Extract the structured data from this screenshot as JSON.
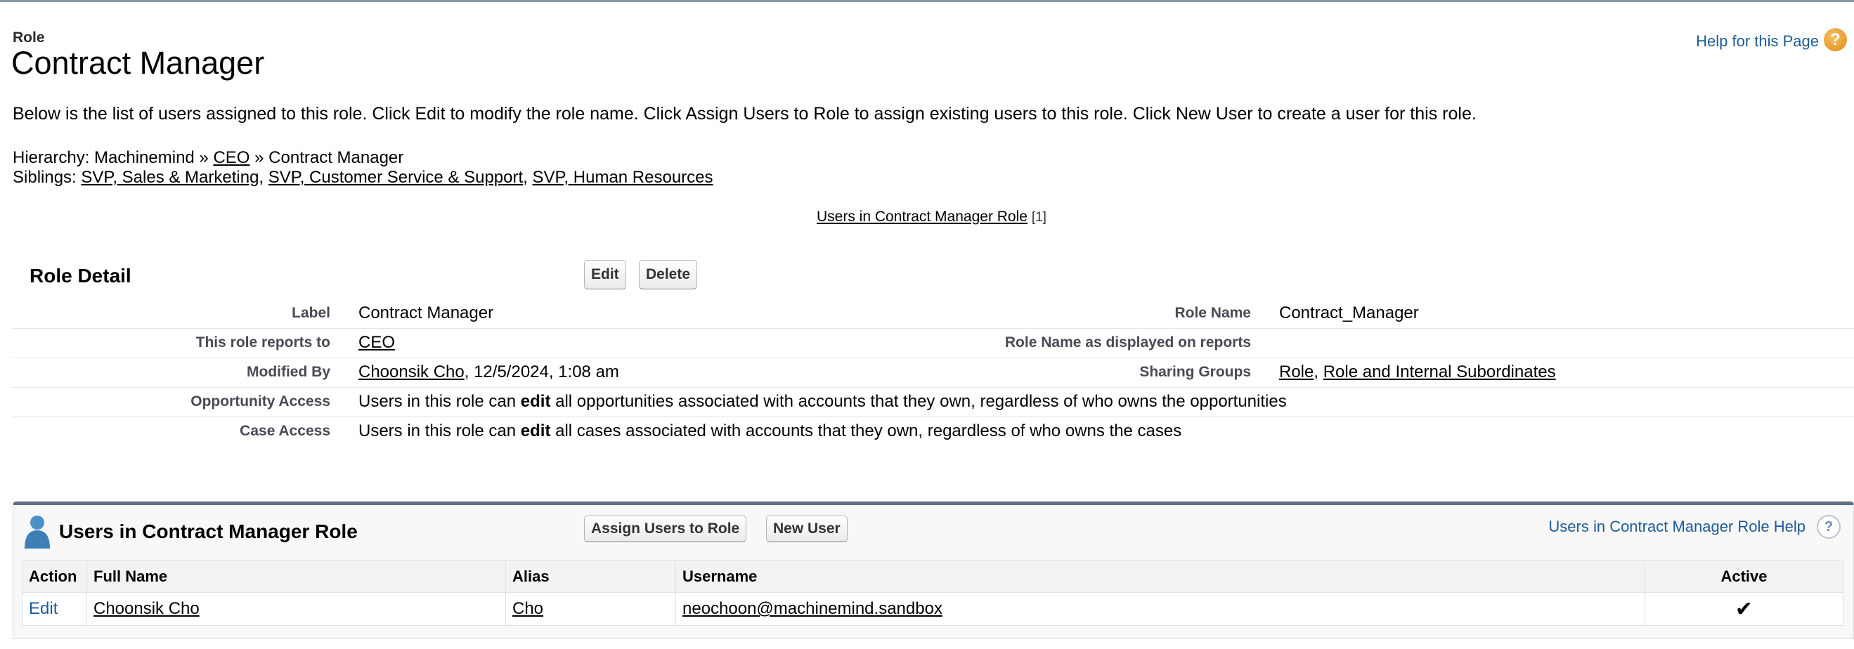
{
  "page": {
    "type": "Role",
    "title": "Contract Manager",
    "help_link": "Help for this Page",
    "intro": "Below is the list of users assigned to this role. Click Edit to modify the role name. Click Assign Users to Role to assign existing users to this role. Click New User to create a user for this role."
  },
  "hierarchy": {
    "prefix": "Hierarchy: Machinemind »",
    "ceo": "CEO",
    "sep": "»",
    "current": "Contract Manager"
  },
  "siblings": {
    "label": "Siblings:",
    "items": [
      "SVP, Sales & Marketing",
      "SVP, Customer Service & Support",
      "SVP, Human Resources"
    ],
    "sep": ","
  },
  "jump": {
    "label": "Users in Contract Manager Role",
    "count": "[1]"
  },
  "role_detail": {
    "title": "Role Detail",
    "edit": "Edit",
    "delete": "Delete",
    "label_label": "Label",
    "label_value": "Contract Manager",
    "role_name_label": "Role Name",
    "role_name_value": "Contract_Manager",
    "reports_to_label": "This role reports to",
    "reports_to_value": "CEO",
    "reports_name_label": "Role Name as displayed on reports",
    "reports_name_value": "",
    "modified_by_label": "Modified By",
    "modified_by_user": "Choonsik Cho",
    "modified_by_date": ", 12/5/2024, 1:08 am",
    "sharing_groups_label": "Sharing Groups",
    "sharing_group_1": "Role",
    "sharing_group_2": "Role and Internal Subordinates",
    "opp_access_label": "Opportunity Access",
    "opp_access_pre": "Users in this role can ",
    "opp_access_bold": "edit",
    "opp_access_post": " all opportunities associated with accounts that they own, regardless of who owns the opportunities",
    "case_access_label": "Case Access",
    "case_access_pre": "Users in this role can ",
    "case_access_bold": "edit",
    "case_access_post": " all cases associated with accounts that they own, regardless of who owns the cases"
  },
  "users_list": {
    "title": "Users in Contract Manager Role",
    "assign_button": "Assign Users to Role",
    "new_user_button": "New User",
    "help": "Users in Contract Manager Role Help",
    "columns": [
      "Action",
      "Full Name",
      "Alias",
      "Username",
      "Active"
    ],
    "rows": [
      {
        "action": "Edit",
        "full_name": "Choonsik Cho",
        "alias": "Cho",
        "username": "neochoon@machinemind.sandbox",
        "active": "✔"
      }
    ]
  },
  "colors": {
    "link_blue": "#1f5a96",
    "related_list_border": "#5f6e83",
    "help_orange": "#e08b12"
  }
}
